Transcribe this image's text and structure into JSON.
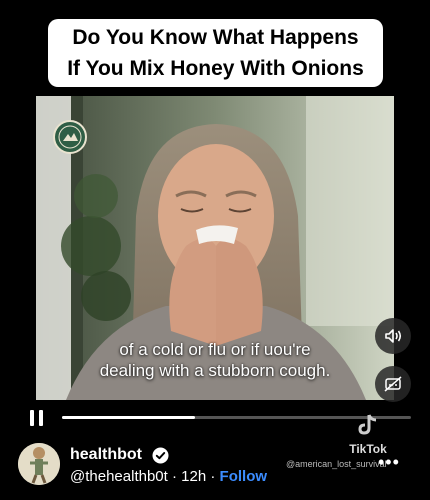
{
  "overlay_title": {
    "line1": "Do You Know What Happens",
    "line2": "If You Mix Honey With Onions"
  },
  "video": {
    "caption_line1": "of a cold or flu or if uou're",
    "caption_line2": "dealing with a stubborn cough.",
    "progress": 0.38,
    "logo_icon": "american-lost-survival-logo"
  },
  "watermark": {
    "brand": "TikTok",
    "handle": "@american_lost_survival"
  },
  "post": {
    "username": "healthbot",
    "handle": "@thehealthb0t",
    "separator": "·",
    "age": "12h",
    "follow_label": "Follow",
    "more_label": "•••"
  },
  "colors": {
    "follow": "#3b8cff",
    "background": "#000000"
  }
}
